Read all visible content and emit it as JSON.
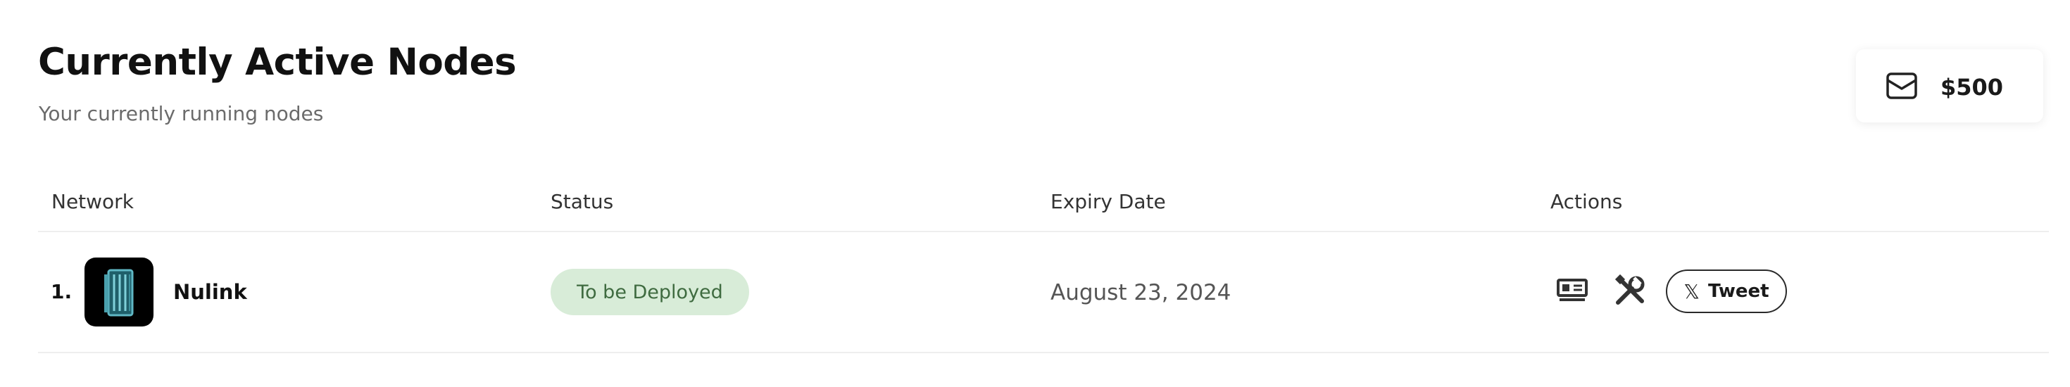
{
  "header": {
    "title": "Currently Active Nodes",
    "subtitle": "Your currently running nodes"
  },
  "balance": {
    "icon": "envelope-icon",
    "amount": "$500"
  },
  "table": {
    "columns": [
      "Network",
      "Status",
      "Expiry Date",
      "Actions"
    ],
    "rows": [
      {
        "index": "1.",
        "network": "Nulink",
        "logo_icon": "nulink-logo",
        "status": "To be Deployed",
        "status_color": "#3f6b40",
        "status_bg": "#d8ecd8",
        "expiry": "August 23, 2024",
        "actions": {
          "monitor_icon": "server-icon",
          "tools_icon": "tools-icon",
          "tweet_icon": "x-logo-icon",
          "tweet_label": "Tweet"
        }
      }
    ]
  }
}
